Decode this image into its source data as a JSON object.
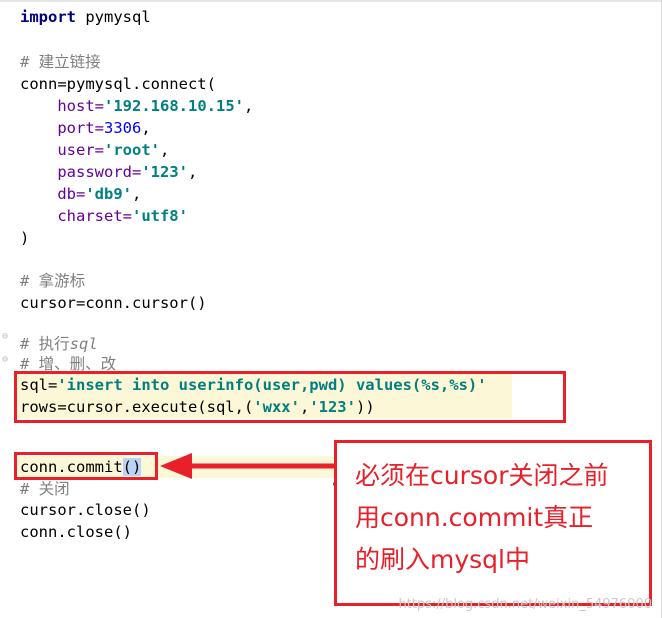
{
  "code": {
    "import_kw": "import",
    "import_mod": " pymysql",
    "comment_connect": "# 建立链接",
    "conn_open": "conn=pymysql.connect(",
    "host_param": "host=",
    "host_value": "'192.168.10.15'",
    "port_param": "port=",
    "port_value": "3306",
    "user_param": "user=",
    "user_value": "'root'",
    "password_param": "password=",
    "password_value": "'123'",
    "db_param": "db=",
    "db_value": "'db9'",
    "charset_param": "charset=",
    "charset_value": "'utf8'",
    "comma": ",",
    "close_paren": ")",
    "comment_cursor": "# 拿游标",
    "cursor_line": "cursor=conn.cursor()",
    "comment_exec_prefix": "# 执行",
    "comment_exec_sql": "sql",
    "comment_crud": "# 增、删、改",
    "sql_assign": "sql=",
    "sql_string": "'insert into userinfo(user,pwd) values(%s,%s)'",
    "rows_line_prefix": "rows=cursor.execute(sql,(",
    "rows_arg1": "'wxx'",
    "rows_arg2": "'123'",
    "rows_line_suffix": "))",
    "commit_prefix": "conn.commit",
    "commit_parens": "()",
    "comment_close": "# 关闭",
    "cursor_close": "cursor.close()",
    "conn_close": "conn.close()"
  },
  "annotation": {
    "callout_line1": "必须在cursor关闭之前",
    "callout_line2": "用conn.commit真正",
    "callout_line3": "的刷入mysql中",
    "accent_color": "#e8202a"
  },
  "watermark": "https://blog.csdn.net/weixin_54976000"
}
